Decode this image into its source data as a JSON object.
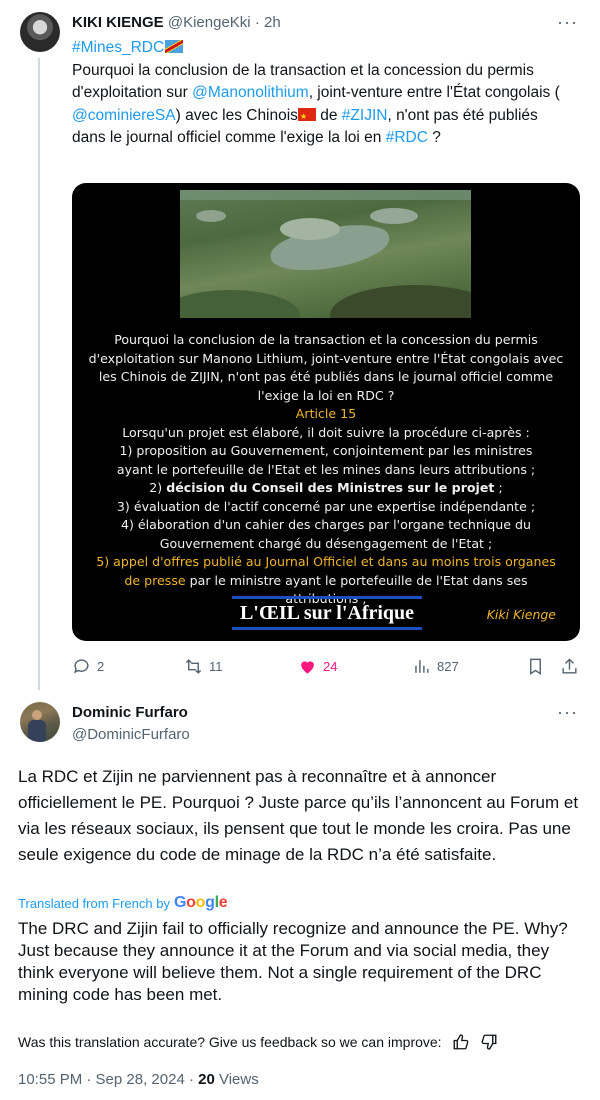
{
  "tweet": {
    "author_name": "KIKI KIENGE",
    "author_handle": "@KiengeKki",
    "separator": "·",
    "time": "2h",
    "more_label": "···",
    "hashtag_mines": "#Mines_RDC",
    "text_a": "Pourquoi la conclusion de la transaction et la concession du permis d'exploitation sur ",
    "mention_manono": "@Manonolithium",
    "text_b": ", joint-venture entre l'État congolais ( ",
    "mention_cominiere": "@cominiereSA",
    "text_c": ") avec les Chinois",
    "text_d": " de ",
    "hashtag_zijin": "#ZIJIN",
    "text_e": ", n'ont pas été publiés dans le journal officiel comme l'exige la loi en ",
    "hashtag_rdc": "#RDC",
    "text_f": " ?",
    "media": {
      "intro": "Pourquoi la conclusion de la transaction et la concession du permis d'exploitation sur Manono Lithium, joint-venture entre l'État congolais avec les Chinois de ZIJIN, n'ont pas été publiés dans le journal officiel comme l'exige la loi en RDC ?",
      "article": "Article 15",
      "lead": "Lorsqu'un projet est élaboré, il doit suivre la procédure ci-après :",
      "item1": "1) proposition au Gouvernement, conjointement par les ministres ayant le portefeuille de l'Etat et les mines dans leurs attributions ;",
      "item2_prefix": "2) ",
      "item2_bold": "décision du Conseil des Ministres sur le projet",
      "item2_suffix": " ;",
      "item3": "3) évaluation de l'actif concerné par une expertise indépendante ;",
      "item4": "4) élaboration d'un cahier des charges par l'organe technique du Gouvernement chargé du désengagement de l'Etat ;",
      "item5_gold": "5) appel d'offres publié au Journal Officiel et dans au moins trois organes de presse",
      "item5_rest": " par le ministre ayant le portefeuille de l'Etat dans ses attributions ;",
      "brand": "L'ŒIL sur l'Afrique",
      "signature": "Kiki Kienge"
    },
    "stats": {
      "replies": "2",
      "retweets": "11",
      "likes": "24",
      "views": "827"
    },
    "colors": {
      "like": "#f91880",
      "link": "#1d9bf0",
      "muted": "#536471"
    }
  },
  "reply": {
    "author_name": "Dominic Furfaro",
    "author_handle": "@DominicFurfaro",
    "more_label": "···",
    "text": "La RDC et Zijin ne parviennent pas à reconnaître et à annoncer officiellement le PE. Pourquoi ? Juste parce qu’ils l’annoncent au Forum et via les réseaux sociaux, ils pensent que tout le monde les croira. Pas une seule exigence du code de minage de la RDC n’a été satisfaite.",
    "translated_label": "Translated from French by",
    "translator": "Google",
    "translation": "The DRC and Zijin fail to officially recognize and announce the PE. Why? Just because they announce it at the Forum and via social media, they think everyone will believe them. Not a single requirement of the DRC mining code has been met.",
    "feedback_prompt": "Was this translation accurate? Give us feedback so we can improve:",
    "timestamp": "10:55 PM · Sep 28, 2024 · ",
    "views_count": "20",
    "views_label": " Views"
  }
}
